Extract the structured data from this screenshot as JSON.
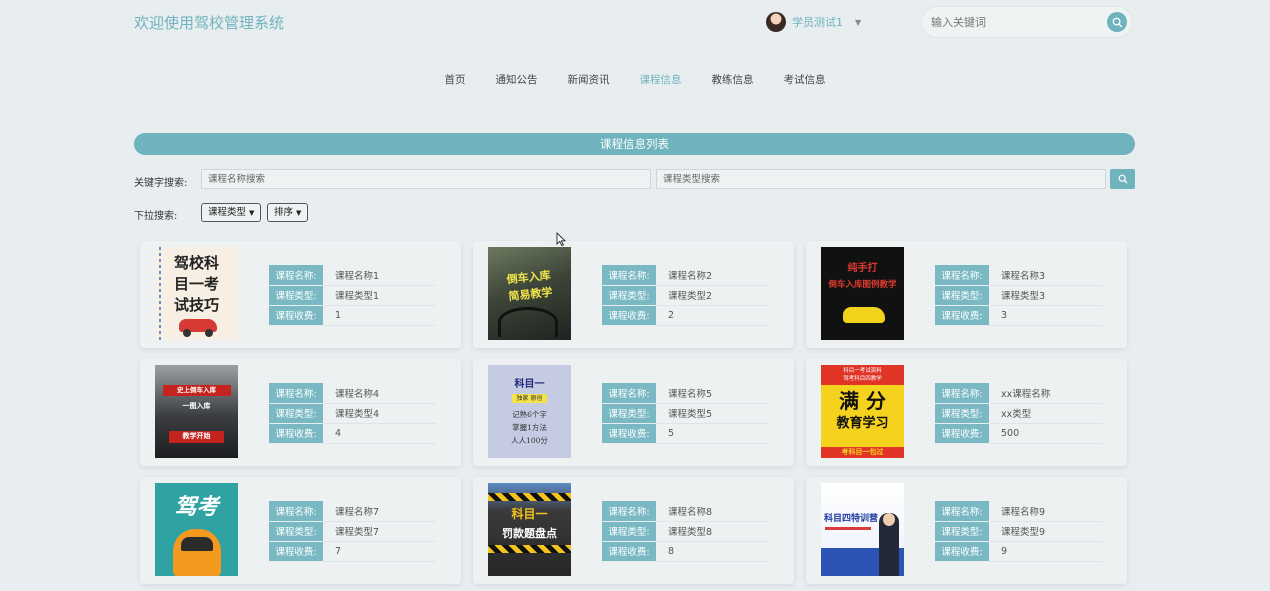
{
  "header": {
    "site_title": "欢迎使用驾校管理系统",
    "user_name": "学员测试1",
    "search_placeholder": "输入关键词"
  },
  "nav": [
    "首页",
    "通知公告",
    "新闻资讯",
    "课程信息",
    "教练信息",
    "考试信息"
  ],
  "nav_active": "课程信息",
  "list_title": "课程信息列表",
  "filters": {
    "keyword_label": "关键字搜索:",
    "name_placeholder": "课程名称搜索",
    "type_placeholder": "课程类型搜索",
    "dropdown_label": "下拉搜索:",
    "type_dropdown": "课程类型",
    "sort_dropdown": "排序"
  },
  "field_labels": {
    "name": "课程名称:",
    "type": "课程类型:",
    "fee": "课程收费:"
  },
  "courses": [
    {
      "name": "课程名称1",
      "type": "课程类型1",
      "fee": "1",
      "thumb_lines": [
        "驾校科",
        "目一考",
        "试技巧"
      ]
    },
    {
      "name": "课程名称2",
      "type": "课程类型2",
      "fee": "2",
      "thumb_lines": [
        "倒车入库",
        "简易教学"
      ]
    },
    {
      "name": "课程名称3",
      "type": "课程类型3",
      "fee": "3",
      "thumb_lines": [
        "纯手打",
        "倒车入库图例教学"
      ]
    },
    {
      "name": "课程名称4",
      "type": "课程类型4",
      "fee": "4",
      "thumb_lines": [
        "史上倒车入库",
        "一图入库",
        "教学开始"
      ]
    },
    {
      "name": "课程名称5",
      "type": "课程类型5",
      "fee": "5",
      "thumb_lines": [
        "科目一",
        "独家 原创",
        "记熟6个字",
        "掌握1方法",
        "人人100分"
      ]
    },
    {
      "name": "xx课程名称",
      "type": "xx类型",
      "fee": "500",
      "thumb_lines": [
        "科目一考试资料",
        "驾考科目四教学",
        "满 分",
        "教育学习",
        "考科目一包过"
      ]
    },
    {
      "name": "课程名称7",
      "type": "课程类型7",
      "fee": "7",
      "thumb_lines": [
        "驾考"
      ]
    },
    {
      "name": "课程名称8",
      "type": "课程类型8",
      "fee": "8",
      "thumb_lines": [
        "科目一",
        "罚款题盘点"
      ]
    },
    {
      "name": "课程名称9",
      "type": "课程类型9",
      "fee": "9",
      "thumb_lines": [
        "科目四特训营"
      ]
    }
  ],
  "colors": {
    "accent": "#6fb3bd",
    "label_bg": "#7ab9c3",
    "page_bg": "#e8eef0"
  },
  "icons": {
    "search": "search-icon",
    "avatar": "avatar",
    "caret": "chevron-down-icon"
  }
}
